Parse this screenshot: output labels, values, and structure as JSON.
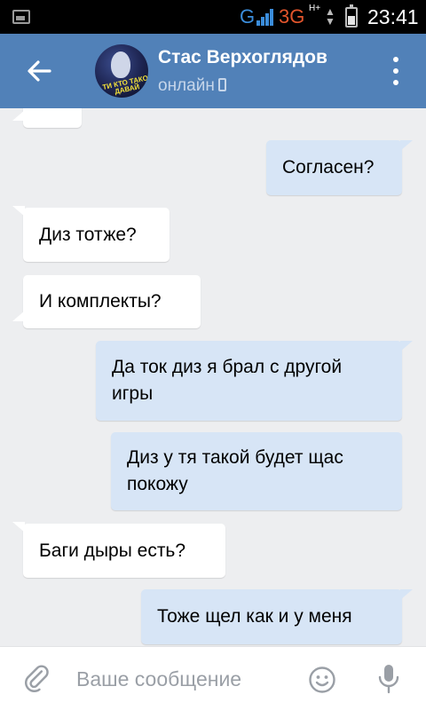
{
  "status_bar": {
    "network_g": "G",
    "network_3g": "3G",
    "network_hplus": "H+",
    "time": "23:41"
  },
  "header": {
    "contact_name": "Стас Верхоглядов",
    "contact_status": "онлайн",
    "avatar_line1": "ТИ КТО ТАКОЙ",
    "avatar_line2": "ДАВАЙ"
  },
  "messages": [
    {
      "direction": "in",
      "text": ""
    },
    {
      "direction": "out",
      "text": "Согласен?"
    },
    {
      "direction": "in",
      "text": "Диз тотже?"
    },
    {
      "direction": "in",
      "text": "И комплекты?"
    },
    {
      "direction": "out",
      "text": "Да ток диз я брал с другой игры"
    },
    {
      "direction": "out",
      "text": "Диз у тя такой будет щас покожу"
    },
    {
      "direction": "in",
      "text": "Баги дыры есть?"
    },
    {
      "direction": "out",
      "text": "Тоже щел как и у меня"
    }
  ],
  "input": {
    "placeholder": "Ваше сообщение"
  },
  "icons": {
    "back": "arrow-left-icon",
    "menu": "more-vertical-icon",
    "attach": "paperclip-icon",
    "emoji": "smile-icon",
    "mic": "microphone-icon"
  },
  "colors": {
    "header": "#5181b8",
    "background": "#edeef0",
    "outgoing_bubble": "#d7e5f6",
    "incoming_bubble": "#ffffff"
  }
}
